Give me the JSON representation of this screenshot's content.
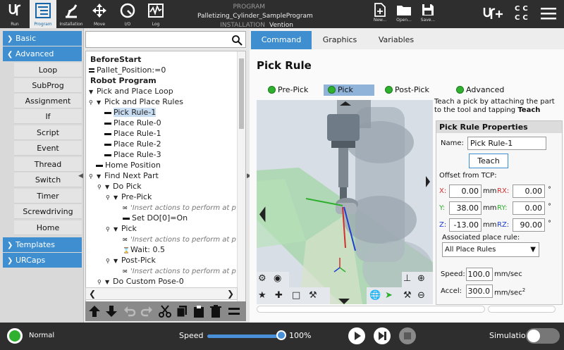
{
  "topbar": {
    "nav": [
      {
        "label": "Run",
        "icon": "ur-logo-icon"
      },
      {
        "label": "Program",
        "icon": "program-icon"
      },
      {
        "label": "Installation",
        "icon": "installation-icon"
      },
      {
        "label": "Move",
        "icon": "move-icon"
      },
      {
        "label": "I/O",
        "icon": "io-icon"
      },
      {
        "label": "Log",
        "icon": "log-icon"
      }
    ],
    "program_key": "PROGRAM",
    "program_value": "Palletizing_Cylinder_SampleProgram",
    "installation_key": "INSTALLATION",
    "installation_value": "Vention",
    "file_buttons": [
      {
        "label": "New...",
        "icon": "new-file-icon"
      },
      {
        "label": "Open...",
        "icon": "open-folder-icon"
      },
      {
        "label": "Save...",
        "icon": "save-icon"
      }
    ],
    "cc": [
      "C",
      "C",
      "C",
      "C"
    ]
  },
  "leftnav": {
    "basic": "Basic",
    "advanced": "Advanced",
    "advanced_items": [
      "Loop",
      "SubProg",
      "Assignment",
      "If",
      "Script",
      "Event",
      "Thread",
      "Switch",
      "Timer",
      "Screwdriving",
      "Home"
    ],
    "templates": "Templates",
    "urcaps": "URCaps"
  },
  "tree": {
    "nodes": [
      {
        "text": "BeforeStart"
      },
      {
        "text": "Pallet_Position:=0"
      },
      {
        "text": "Robot Program"
      },
      {
        "text": "Pick and Place Loop"
      },
      {
        "text": "Pick and Place Rules"
      },
      {
        "text": "Pick Rule-1"
      },
      {
        "text": "Place Rule-0"
      },
      {
        "text": "Place Rule-1"
      },
      {
        "text": "Place Rule-2"
      },
      {
        "text": "Place Rule-3"
      },
      {
        "text": "Home Position"
      },
      {
        "text": "Find Next Part"
      },
      {
        "text": "Do Pick"
      },
      {
        "text": "Pre-Pick"
      },
      {
        "text": "'Insert actions to perform at p"
      },
      {
        "text": "Set DO[0]=On"
      },
      {
        "text": "Pick"
      },
      {
        "text": "'Insert actions to perform at p"
      },
      {
        "text": "Wait: 0.5"
      },
      {
        "text": "Post-Pick"
      },
      {
        "text": "'Insert actions to perform at p"
      },
      {
        "text": "Do Custom Pose-0"
      }
    ]
  },
  "tabs": [
    "Command",
    "Graphics",
    "Variables"
  ],
  "command": {
    "title": "Pick Rule",
    "phases": [
      "Pre-Pick",
      "Pick",
      "Post-Pick",
      "Advanced"
    ],
    "instruction": "Teach a pick by attaching the part to the tool and tapping",
    "instruction_bold": "Teach",
    "props_title": "Pick Rule Properties",
    "name_label": "Name:",
    "name_value": "Pick Rule-1",
    "teach_label": "Teach",
    "offset_label": "Offset from TCP:",
    "x_label": "X:",
    "x_value": "0.00",
    "y_label": "Y:",
    "y_value": "38.00",
    "z_label": "Z:",
    "z_value": "-13.00",
    "rx_label": "RX:",
    "rx_value": "0.00",
    "ry_label": "RY:",
    "ry_value": "0.00",
    "rz_label": "RZ:",
    "rz_value": "90.00",
    "mm": "mm",
    "deg": "°",
    "assoc_label": "Associated place rule:",
    "assoc_value": "All Place Rules",
    "speed_label": "Speed:",
    "speed_value": "100.0",
    "speed_unit": "mm/sec",
    "accel_label": "Accel:",
    "accel_value": "300.0",
    "accel_unit": "mm/sec",
    "accel_sup": "2"
  },
  "footer": {
    "status": "Normal",
    "speed_label": "Speed",
    "speed_value": "100%",
    "speed_fraction": 1.0,
    "simulation_label": "Simulation"
  }
}
